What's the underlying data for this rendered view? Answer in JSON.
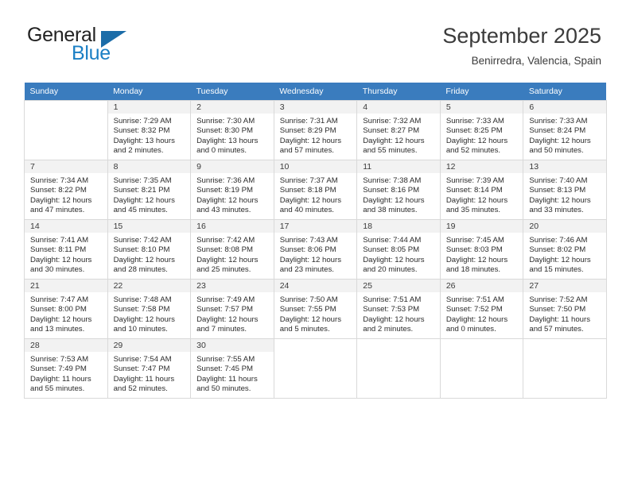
{
  "brand": {
    "name_part1": "General",
    "name_part2": "Blue",
    "triangle_icon": "triangle-icon"
  },
  "header": {
    "month_title": "September 2025",
    "location": "Benirredra, Valencia, Spain"
  },
  "colors": {
    "header_row_bg": "#3a7cbe",
    "brand_blue": "#1b7fc4",
    "daynum_bg": "#f2f2f2",
    "grid_border": "#d9d9d9"
  },
  "calendar": {
    "weekday_headers": [
      "Sunday",
      "Monday",
      "Tuesday",
      "Wednesday",
      "Thursday",
      "Friday",
      "Saturday"
    ],
    "labels": {
      "sunrise": "Sunrise:",
      "sunset": "Sunset:",
      "daylight": "Daylight:"
    },
    "weeks": [
      [
        {
          "empty": true
        },
        {
          "day": "1",
          "sunrise": "Sunrise: 7:29 AM",
          "sunset": "Sunset: 8:32 PM",
          "daylight_1": "Daylight: 13 hours",
          "daylight_2": "and 2 minutes."
        },
        {
          "day": "2",
          "sunrise": "Sunrise: 7:30 AM",
          "sunset": "Sunset: 8:30 PM",
          "daylight_1": "Daylight: 13 hours",
          "daylight_2": "and 0 minutes."
        },
        {
          "day": "3",
          "sunrise": "Sunrise: 7:31 AM",
          "sunset": "Sunset: 8:29 PM",
          "daylight_1": "Daylight: 12 hours",
          "daylight_2": "and 57 minutes."
        },
        {
          "day": "4",
          "sunrise": "Sunrise: 7:32 AM",
          "sunset": "Sunset: 8:27 PM",
          "daylight_1": "Daylight: 12 hours",
          "daylight_2": "and 55 minutes."
        },
        {
          "day": "5",
          "sunrise": "Sunrise: 7:33 AM",
          "sunset": "Sunset: 8:25 PM",
          "daylight_1": "Daylight: 12 hours",
          "daylight_2": "and 52 minutes."
        },
        {
          "day": "6",
          "sunrise": "Sunrise: 7:33 AM",
          "sunset": "Sunset: 8:24 PM",
          "daylight_1": "Daylight: 12 hours",
          "daylight_2": "and 50 minutes."
        }
      ],
      [
        {
          "day": "7",
          "sunrise": "Sunrise: 7:34 AM",
          "sunset": "Sunset: 8:22 PM",
          "daylight_1": "Daylight: 12 hours",
          "daylight_2": "and 47 minutes."
        },
        {
          "day": "8",
          "sunrise": "Sunrise: 7:35 AM",
          "sunset": "Sunset: 8:21 PM",
          "daylight_1": "Daylight: 12 hours",
          "daylight_2": "and 45 minutes."
        },
        {
          "day": "9",
          "sunrise": "Sunrise: 7:36 AM",
          "sunset": "Sunset: 8:19 PM",
          "daylight_1": "Daylight: 12 hours",
          "daylight_2": "and 43 minutes."
        },
        {
          "day": "10",
          "sunrise": "Sunrise: 7:37 AM",
          "sunset": "Sunset: 8:18 PM",
          "daylight_1": "Daylight: 12 hours",
          "daylight_2": "and 40 minutes."
        },
        {
          "day": "11",
          "sunrise": "Sunrise: 7:38 AM",
          "sunset": "Sunset: 8:16 PM",
          "daylight_1": "Daylight: 12 hours",
          "daylight_2": "and 38 minutes."
        },
        {
          "day": "12",
          "sunrise": "Sunrise: 7:39 AM",
          "sunset": "Sunset: 8:14 PM",
          "daylight_1": "Daylight: 12 hours",
          "daylight_2": "and 35 minutes."
        },
        {
          "day": "13",
          "sunrise": "Sunrise: 7:40 AM",
          "sunset": "Sunset: 8:13 PM",
          "daylight_1": "Daylight: 12 hours",
          "daylight_2": "and 33 minutes."
        }
      ],
      [
        {
          "day": "14",
          "sunrise": "Sunrise: 7:41 AM",
          "sunset": "Sunset: 8:11 PM",
          "daylight_1": "Daylight: 12 hours",
          "daylight_2": "and 30 minutes."
        },
        {
          "day": "15",
          "sunrise": "Sunrise: 7:42 AM",
          "sunset": "Sunset: 8:10 PM",
          "daylight_1": "Daylight: 12 hours",
          "daylight_2": "and 28 minutes."
        },
        {
          "day": "16",
          "sunrise": "Sunrise: 7:42 AM",
          "sunset": "Sunset: 8:08 PM",
          "daylight_1": "Daylight: 12 hours",
          "daylight_2": "and 25 minutes."
        },
        {
          "day": "17",
          "sunrise": "Sunrise: 7:43 AM",
          "sunset": "Sunset: 8:06 PM",
          "daylight_1": "Daylight: 12 hours",
          "daylight_2": "and 23 minutes."
        },
        {
          "day": "18",
          "sunrise": "Sunrise: 7:44 AM",
          "sunset": "Sunset: 8:05 PM",
          "daylight_1": "Daylight: 12 hours",
          "daylight_2": "and 20 minutes."
        },
        {
          "day": "19",
          "sunrise": "Sunrise: 7:45 AM",
          "sunset": "Sunset: 8:03 PM",
          "daylight_1": "Daylight: 12 hours",
          "daylight_2": "and 18 minutes."
        },
        {
          "day": "20",
          "sunrise": "Sunrise: 7:46 AM",
          "sunset": "Sunset: 8:02 PM",
          "daylight_1": "Daylight: 12 hours",
          "daylight_2": "and 15 minutes."
        }
      ],
      [
        {
          "day": "21",
          "sunrise": "Sunrise: 7:47 AM",
          "sunset": "Sunset: 8:00 PM",
          "daylight_1": "Daylight: 12 hours",
          "daylight_2": "and 13 minutes."
        },
        {
          "day": "22",
          "sunrise": "Sunrise: 7:48 AM",
          "sunset": "Sunset: 7:58 PM",
          "daylight_1": "Daylight: 12 hours",
          "daylight_2": "and 10 minutes."
        },
        {
          "day": "23",
          "sunrise": "Sunrise: 7:49 AM",
          "sunset": "Sunset: 7:57 PM",
          "daylight_1": "Daylight: 12 hours",
          "daylight_2": "and 7 minutes."
        },
        {
          "day": "24",
          "sunrise": "Sunrise: 7:50 AM",
          "sunset": "Sunset: 7:55 PM",
          "daylight_1": "Daylight: 12 hours",
          "daylight_2": "and 5 minutes."
        },
        {
          "day": "25",
          "sunrise": "Sunrise: 7:51 AM",
          "sunset": "Sunset: 7:53 PM",
          "daylight_1": "Daylight: 12 hours",
          "daylight_2": "and 2 minutes."
        },
        {
          "day": "26",
          "sunrise": "Sunrise: 7:51 AM",
          "sunset": "Sunset: 7:52 PM",
          "daylight_1": "Daylight: 12 hours",
          "daylight_2": "and 0 minutes."
        },
        {
          "day": "27",
          "sunrise": "Sunrise: 7:52 AM",
          "sunset": "Sunset: 7:50 PM",
          "daylight_1": "Daylight: 11 hours",
          "daylight_2": "and 57 minutes."
        }
      ],
      [
        {
          "day": "28",
          "sunrise": "Sunrise: 7:53 AM",
          "sunset": "Sunset: 7:49 PM",
          "daylight_1": "Daylight: 11 hours",
          "daylight_2": "and 55 minutes."
        },
        {
          "day": "29",
          "sunrise": "Sunrise: 7:54 AM",
          "sunset": "Sunset: 7:47 PM",
          "daylight_1": "Daylight: 11 hours",
          "daylight_2": "and 52 minutes."
        },
        {
          "day": "30",
          "sunrise": "Sunrise: 7:55 AM",
          "sunset": "Sunset: 7:45 PM",
          "daylight_1": "Daylight: 11 hours",
          "daylight_2": "and 50 minutes."
        },
        {
          "empty": true
        },
        {
          "empty": true
        },
        {
          "empty": true
        },
        {
          "empty": true
        }
      ]
    ]
  }
}
